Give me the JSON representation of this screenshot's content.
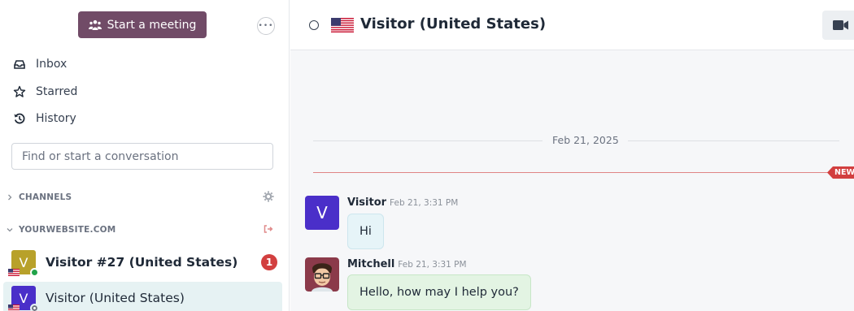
{
  "sidebar": {
    "meeting_button": "Start a meeting",
    "nav": [
      {
        "label": "Inbox",
        "icon": "inbox-icon"
      },
      {
        "label": "Starred",
        "icon": "star-icon"
      },
      {
        "label": "History",
        "icon": "history-icon"
      }
    ],
    "search_placeholder": "Find or start a conversation",
    "sections": {
      "channels": "CHANNELS",
      "website": "YOURWEBSITE.COM"
    },
    "conversations": [
      {
        "name": "Visitor #27 (United States)",
        "initial": "V",
        "avatar_color": "#b8a12a",
        "status": "online",
        "unread": "1"
      },
      {
        "name": "Visitor (United States)",
        "initial": "V",
        "avatar_color": "#4a2fc9",
        "status": "away"
      }
    ]
  },
  "thread": {
    "title": "Visitor (United States)",
    "date_divider": "Feb 21, 2025",
    "new_tag": "NEW",
    "messages": [
      {
        "author": "Visitor",
        "time": "Feb 21, 3:31 PM",
        "text": "Hi",
        "initial": "V"
      },
      {
        "author": "Mitchell",
        "time": "Feb 21, 3:31 PM",
        "text": "Hello, how may I help you?"
      }
    ]
  },
  "colors": {
    "brand": "#714b67",
    "badge": "#d23f3f",
    "online": "#21a34a",
    "active_row": "#e6f2f3"
  }
}
